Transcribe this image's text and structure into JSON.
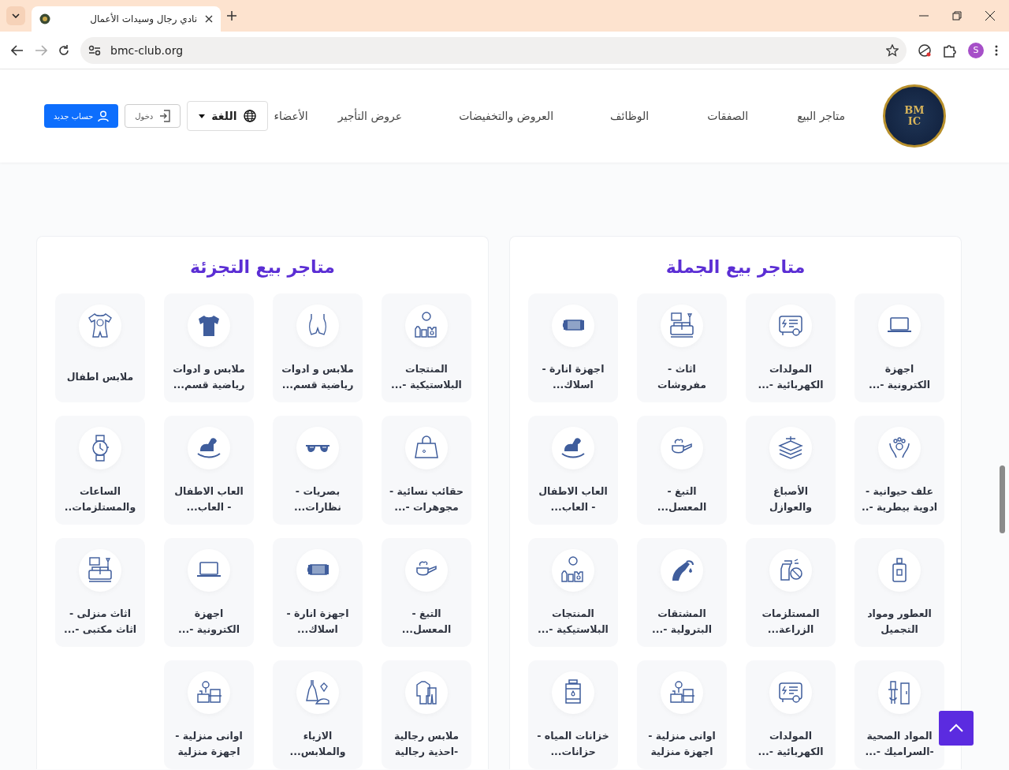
{
  "browser": {
    "tab_title": "نادي رجال وسيدات الأعمال",
    "url": "bmc-club.org",
    "profile_initial": "S"
  },
  "header": {
    "logo_lines": [
      "BM",
      "IC"
    ],
    "nav": [
      "متاجر البيع",
      "الصفقات",
      "الوظائف",
      "العروض والتخفيضات",
      "عروض التأجير",
      "الأعضاء"
    ],
    "language": "اللغة",
    "login": "دخول",
    "register": "حساب جديد"
  },
  "panels": [
    {
      "title": "متاجر بيع الجملة",
      "items": [
        {
          "kind": "laptop",
          "lines": [
            "اجهزة",
            "الكترونية -..."
          ]
        },
        {
          "kind": "generator",
          "lines": [
            "المولدات",
            "الكهربائية -..."
          ]
        },
        {
          "kind": "furniture",
          "lines": [
            "اثاث -",
            "مفروشات"
          ]
        },
        {
          "kind": "lighting",
          "lines": [
            "اجهزة انارة -",
            "اسلاك..."
          ]
        },
        {
          "kind": "paws",
          "lines": [
            "علف حيوانية -",
            "ادوية بيطرية -.."
          ]
        },
        {
          "kind": "paint",
          "lines": [
            "الأصباغ",
            "والعوازل"
          ]
        },
        {
          "kind": "pipe",
          "lines": [
            "التبغ -",
            "المعسل..."
          ]
        },
        {
          "kind": "horse",
          "lines": [
            "العاب الاطفال",
            "- العاب..."
          ]
        },
        {
          "kind": "perfume",
          "lines": [
            "العطور ومواد",
            "التجميل"
          ]
        },
        {
          "kind": "spray",
          "lines": [
            "المستلزمات",
            "الزراعة..."
          ]
        },
        {
          "kind": "fuel",
          "lines": [
            "المشتقات",
            "البترولية -..."
          ]
        },
        {
          "kind": "plastics",
          "lines": [
            "المنتجات",
            "البلاستيكية -..."
          ]
        },
        {
          "kind": "sanitary",
          "lines": [
            "المواد الصحية",
            "-السراميك -..."
          ]
        },
        {
          "kind": "generator",
          "lines": [
            "المولدات",
            "الكهربائية -..."
          ]
        },
        {
          "kind": "kitchen",
          "lines": [
            "اوانى منزلية -",
            "اجهزة منزلية"
          ]
        },
        {
          "kind": "tank",
          "lines": [
            "خزانات المياه -",
            "حزانات..."
          ]
        }
      ]
    },
    {
      "title": "متاجر بيع التجزئة",
      "items": [
        {
          "kind": "plastics",
          "lines": [
            "المنتجات",
            "البلاستيكية -..."
          ]
        },
        {
          "kind": "shorts",
          "lines": [
            "ملابس و ادوات",
            "رياضية قسم..."
          ]
        },
        {
          "kind": "tshirt",
          "lines": [
            "ملابس و ادوات",
            "رياضية قسم..."
          ]
        },
        {
          "kind": "onesie",
          "lines": [
            "ملابس اطفال"
          ]
        },
        {
          "kind": "handbag",
          "lines": [
            "حقائب نسائية -",
            "مجوهرات -..."
          ]
        },
        {
          "kind": "glasses",
          "lines": [
            "بصريات -",
            "نظارات..."
          ]
        },
        {
          "kind": "horse",
          "lines": [
            "العاب الاطفال",
            "- العاب..."
          ]
        },
        {
          "kind": "watch",
          "lines": [
            "الساعات",
            "والمستلزمات.."
          ]
        },
        {
          "kind": "pipe",
          "lines": [
            "التبغ -",
            "المعسل..."
          ]
        },
        {
          "kind": "lighting",
          "lines": [
            "اجهزة انارة -",
            "اسلاك..."
          ]
        },
        {
          "kind": "laptop",
          "lines": [
            "اجهزة",
            "الكترونية -..."
          ]
        },
        {
          "kind": "furniture",
          "lines": [
            "اثاث منزلى -",
            "اثاث مكتبى -..."
          ]
        },
        {
          "kind": "menswear",
          "lines": [
            "ملابس رجالية",
            "-احذية رجالية"
          ]
        },
        {
          "kind": "fashion",
          "lines": [
            "الازياء",
            "والملابس..."
          ]
        },
        {
          "kind": "kitchen",
          "lines": [
            "اوانى منزلية -",
            "اجهزة منزلية"
          ]
        }
      ]
    }
  ]
}
